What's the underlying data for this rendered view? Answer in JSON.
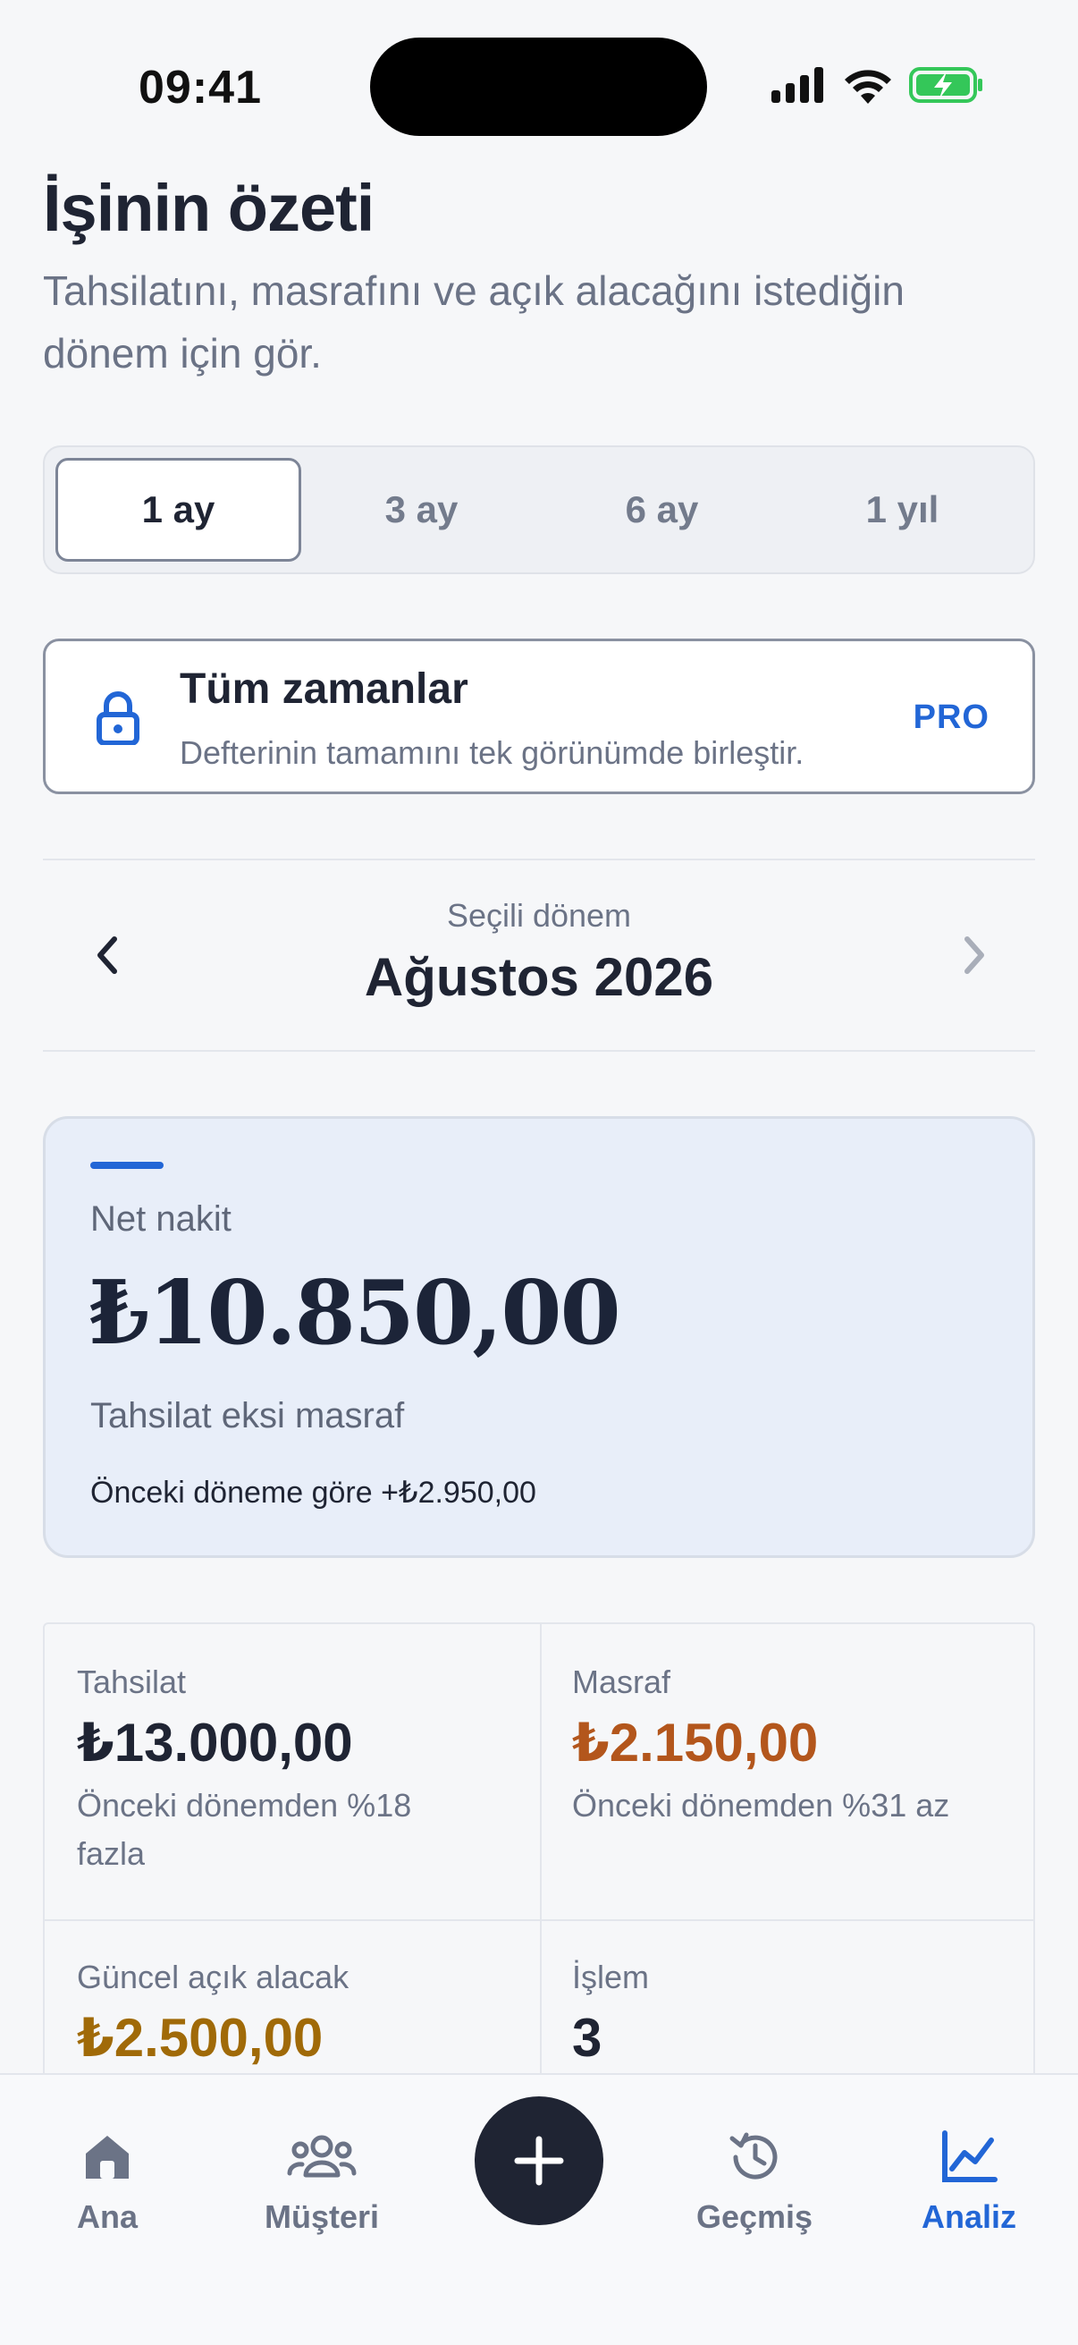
{
  "status_bar": {
    "time": "09:41"
  },
  "header": {
    "title": "İşinin özeti",
    "subtitle": "Tahsilatını, masrafını ve açık alacağını istediğin dönem için gör."
  },
  "period_tabs": [
    {
      "label": "1 ay",
      "active": true
    },
    {
      "label": "3 ay",
      "active": false
    },
    {
      "label": "6 ay",
      "active": false
    },
    {
      "label": "1 yıl",
      "active": false
    }
  ],
  "pro_card": {
    "icon": "lock-icon",
    "title": "Tüm zamanlar",
    "description": "Defterinin tamamını tek görünümde birleştir.",
    "badge": "PRO"
  },
  "period_nav": {
    "label": "Seçili dönem",
    "value": "Ağustos 2026"
  },
  "net_card": {
    "label": "Net nakit",
    "value": "₺10.850,00",
    "subtitle": "Tahsilat eksi masraf",
    "comparison": "Önceki döneme göre +₺2.950,00"
  },
  "stats": [
    {
      "label": "Tahsilat",
      "value": "₺13.000,00",
      "note": "Önceki dönemden %18 fazla",
      "color": "#1f2433"
    },
    {
      "label": "Masraf",
      "value": "₺2.150,00",
      "note": "Önceki dönemden %31 az",
      "color": "#b3561c"
    },
    {
      "label": "Güncel açık alacak",
      "value": "₺2.500,00",
      "note": "",
      "color": "#a06a08"
    },
    {
      "label": "İşlem",
      "value": "3",
      "note": "",
      "color": "#1f2433"
    }
  ],
  "bottom_nav": {
    "items": [
      {
        "label": "Ana",
        "icon": "home-icon"
      },
      {
        "label": "Müşteri",
        "icon": "users-icon"
      },
      {
        "label": "",
        "icon": "plus-icon"
      },
      {
        "label": "Geçmiş",
        "icon": "history-icon"
      },
      {
        "label": "Analiz",
        "icon": "chart-icon",
        "active": true
      }
    ]
  },
  "colors": {
    "accent": "#2266d6",
    "text": "#1f2433",
    "muted": "#6b7386",
    "expense": "#b3561c",
    "receivable": "#a06a08"
  }
}
